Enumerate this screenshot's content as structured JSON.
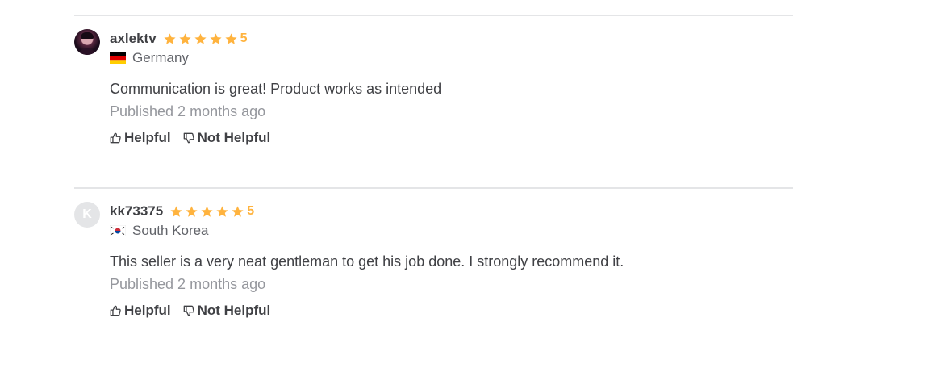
{
  "reviews": [
    {
      "username": "axlektv",
      "rating": "5",
      "stars": 5,
      "country": "Germany",
      "flag_icon": "germany-flag-icon",
      "text": "Communication is great! Product works as intended",
      "published": "Published 2 months ago",
      "helpful_label": "Helpful",
      "not_helpful_label": "Not Helpful",
      "avatar_type": "photo"
    },
    {
      "username": "kk73375",
      "rating": "5",
      "stars": 5,
      "country": "South Korea",
      "flag_icon": "south-korea-flag-icon",
      "avatar_letter": "K",
      "text": "This seller is a very neat gentleman to get his job done. I strongly recommend it.",
      "published": "Published 2 months ago",
      "helpful_label": "Helpful",
      "not_helpful_label": "Not Helpful",
      "avatar_type": "letter"
    }
  ],
  "colors": {
    "star": "#ffb33e",
    "divider": "#e4e5e7",
    "text": "#404145",
    "muted": "#95979d"
  }
}
